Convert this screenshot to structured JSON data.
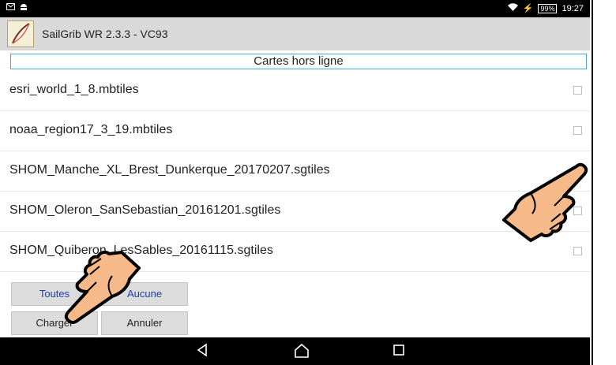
{
  "status": {
    "battery": "99%",
    "time": "19:27"
  },
  "app": {
    "title": "SailGrib WR 2.3.3 - VC93"
  },
  "dialog": {
    "title": "Cartes hors ligne",
    "files": [
      {
        "name": "esri_world_1_8.mbtiles",
        "checked": false
      },
      {
        "name": "noaa_region17_3_19.mbtiles",
        "checked": false
      },
      {
        "name": "SHOM_Manche_XL_Brest_Dunkerque_20170207.sgtiles",
        "checked": true
      },
      {
        "name": "SHOM_Oleron_SanSebastian_20161201.sgtiles",
        "checked": false
      },
      {
        "name": "SHOM_Quiberon_LesSables_20161115.sgtiles",
        "checked": false
      }
    ],
    "buttons": {
      "all": "Toutes",
      "none": "Aucune",
      "load": "Charger",
      "cancel": "Annuler"
    }
  },
  "colors": {
    "accent": "#4aa3df",
    "link_text": "#1f3fa8",
    "skin": "#f5b98a"
  },
  "icons": [
    "mail-icon",
    "android-icon",
    "wifi-icon",
    "battery-icon",
    "back-icon",
    "home-icon",
    "recents-icon",
    "pointing-hand-icon"
  ]
}
